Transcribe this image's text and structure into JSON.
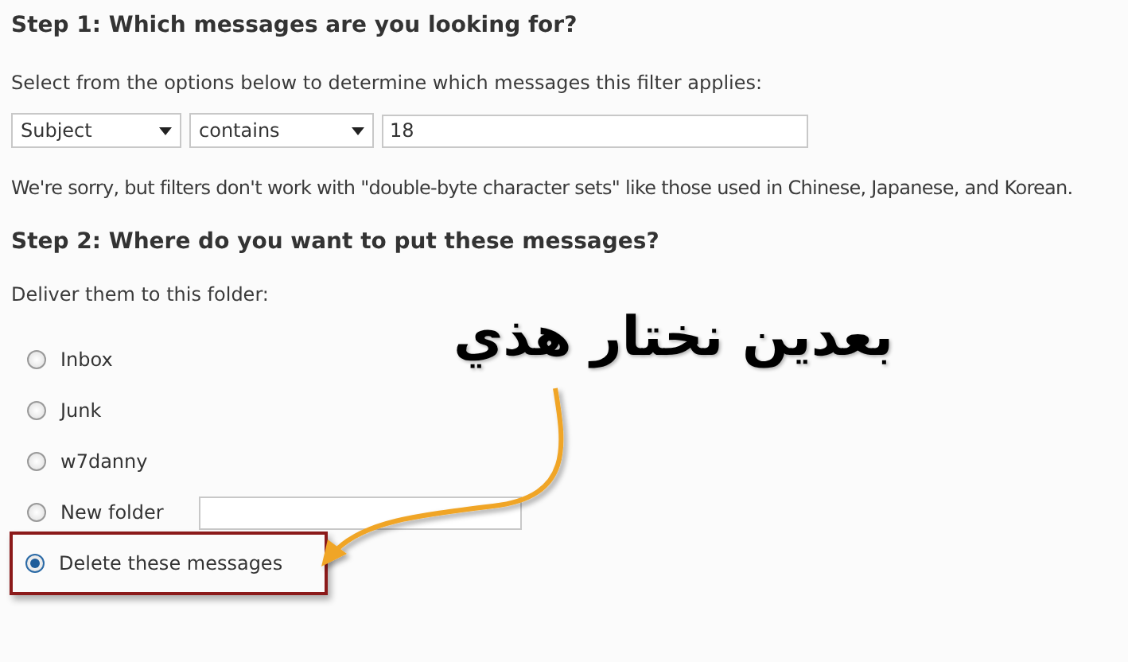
{
  "step1": {
    "heading": "Step 1: Which messages are you looking for?",
    "description": "Select from the options below to determine which messages this filter applies:",
    "field_select": {
      "value": "Subject"
    },
    "operator_select": {
      "value": "contains"
    },
    "text_field": {
      "value": "18"
    },
    "note": "We're sorry, but filters don't work with \"double-byte character sets\" like those used in Chinese, Japanese, and Korean."
  },
  "step2": {
    "heading": "Step 2: Where do you want to put these messages?",
    "description": "Deliver them to this folder:",
    "options": [
      {
        "label": "Inbox",
        "kind": "plain",
        "selected": false,
        "highlighted": false
      },
      {
        "label": "Junk",
        "kind": "plain",
        "selected": false,
        "highlighted": false
      },
      {
        "label": "w7danny",
        "kind": "plain",
        "selected": false,
        "highlighted": false
      },
      {
        "label": "New folder",
        "kind": "with_field",
        "selected": false,
        "highlighted": false
      },
      {
        "label": "Delete these messages",
        "kind": "plain",
        "selected": true,
        "highlighted": true
      }
    ]
  },
  "annotation": {
    "text": "بعدين نختار هذي"
  }
}
